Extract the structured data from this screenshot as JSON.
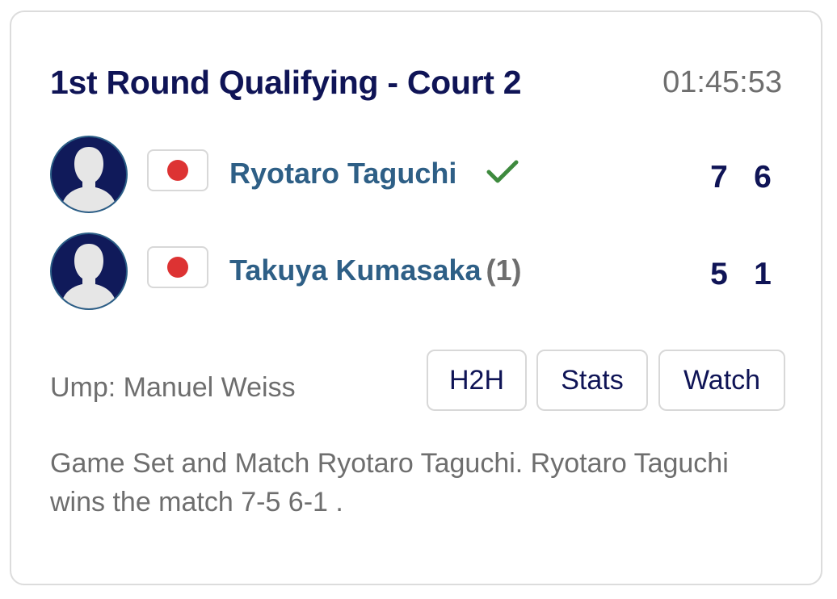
{
  "match": {
    "title": "1st Round Qualifying - Court 2",
    "duration": "01:45:53"
  },
  "players": [
    {
      "name": "Ryotaro Taguchi",
      "seed": "",
      "flag_icon": "japan-flag-icon",
      "winner": true,
      "sets": [
        "7",
        "6"
      ]
    },
    {
      "name": "Takuya Kumasaka",
      "seed": "(1)",
      "flag_icon": "japan-flag-icon",
      "winner": false,
      "sets": [
        "5",
        "1"
      ]
    }
  ],
  "umpire": "Ump: Manuel Weiss",
  "buttons": {
    "h2h": "H2H",
    "stats": "Stats",
    "watch": "Watch"
  },
  "summary": "Game Set and Match Ryotaro Taguchi. Ryotaro Taguchi wins the match 7-5 6-1 .",
  "colors": {
    "title": "#0f1456",
    "player_name": "#2e5f86",
    "muted": "#6e6e6e",
    "winner_check": "#3e8a3e",
    "flag_red": "#dd3333"
  }
}
